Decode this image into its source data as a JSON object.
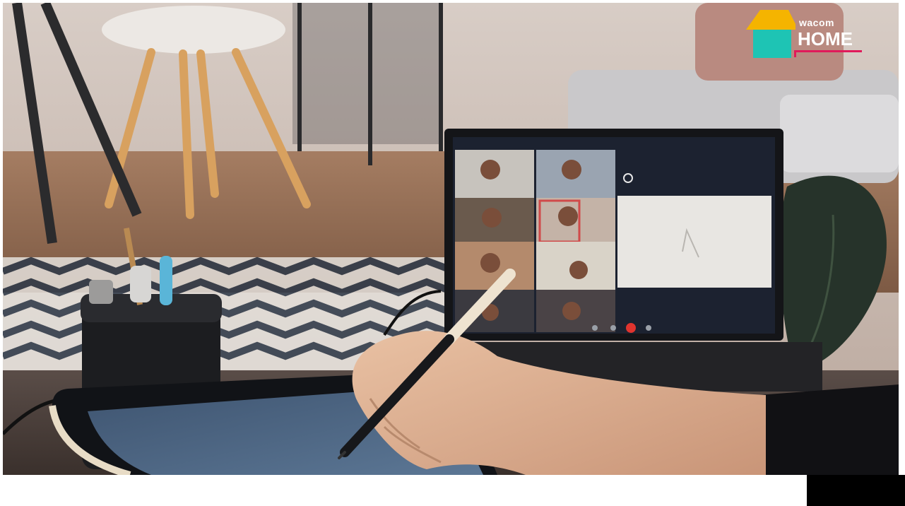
{
  "logo": {
    "brand": "wacom",
    "word": "HOME",
    "colors": {
      "roof": "#f5b400",
      "house": "#1ec4b4",
      "underline": "#e01a5a"
    }
  },
  "scene": {
    "call_controls": [
      "mic-icon",
      "camera-icon",
      "hangup-icon",
      "share-icon"
    ],
    "colors": {
      "hangup": "#e0342e",
      "screen_bg": "#1c2230",
      "whiteboard": "#e8e6e2"
    }
  }
}
